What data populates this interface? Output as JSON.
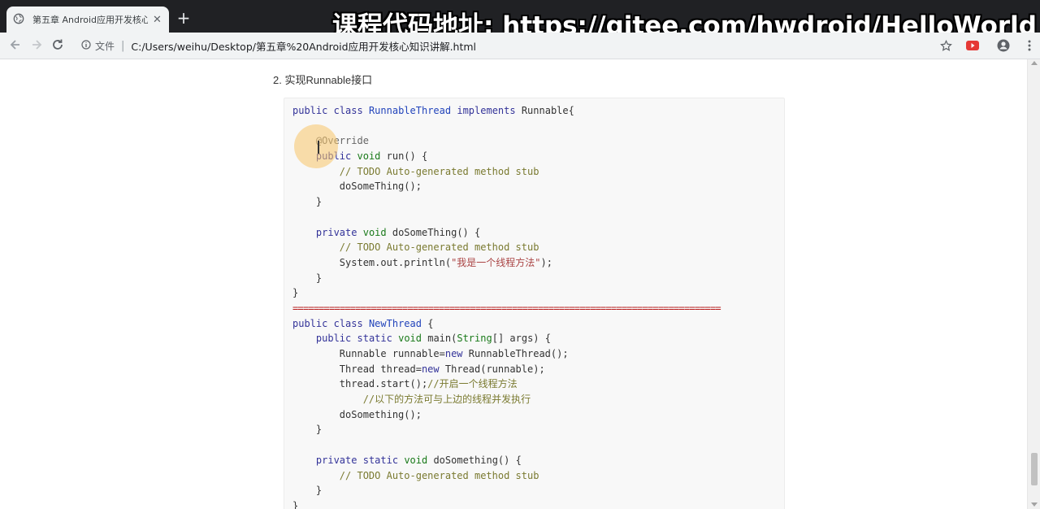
{
  "tab": {
    "title": "第五章 Android应用开发核心知识讲解.html",
    "close": "✕",
    "new_tab": "+"
  },
  "overlay": {
    "text": "课程代码地址: https://gitee.com/hwdroid/HelloWorld"
  },
  "toolbar": {
    "chip_label": "文件",
    "url": "C:/Users/weihu/Desktop/第五章%20Android应用开发核心知识讲解.html",
    "icons": [
      "back-icon",
      "forward-icon",
      "reload-icon",
      "file-info-icon",
      "bookmark-star-icon",
      "extension-icon",
      "account-icon",
      "menu-icon"
    ]
  },
  "content": {
    "heading": "2. 实现Runnable接口",
    "code_lines": [
      "public class RunnableThread implements Runnable{",
      "",
      "    @Override",
      "    public void run() {",
      "        // TODO Auto-generated method stub",
      "        doSomeThing();",
      "    }",
      "",
      "    private void doSomeThing() {",
      "        // TODO Auto-generated method stub",
      "        System.out.println(\"我是一个线程方法\");",
      "    }",
      "}",
      "==================================================================================",
      "public class NewThread {",
      "    public static void main(String[] args) {",
      "        Runnable runnable=new RunnableThread();",
      "        Thread thread=new Thread(runnable);",
      "        thread.start();//开启一个线程方法",
      "            //以下的方法可与上边的线程并发执行",
      "        doSomething();",
      "    }",
      "",
      "    private static void doSomething() {",
      "        // TODO Auto-generated method stub",
      "    }",
      "}"
    ]
  },
  "colors": {
    "keyword": "#333399",
    "type_keyword": "#1a7a1a",
    "class_name": "#2244bb",
    "comment": "#7a7a30",
    "string": "#aa4444",
    "separator": "#b81c1c"
  }
}
